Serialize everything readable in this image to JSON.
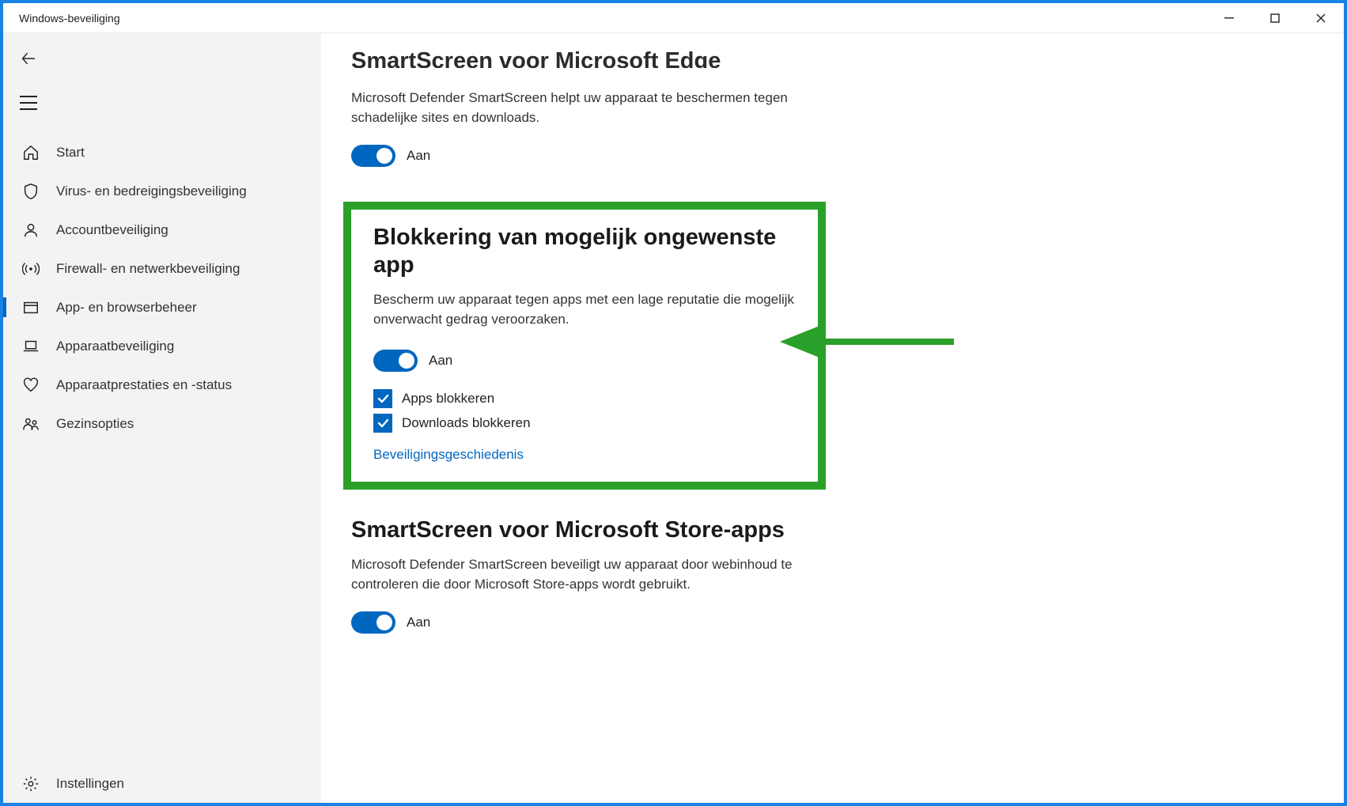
{
  "window": {
    "title": "Windows-beveiliging"
  },
  "sidebar": {
    "items": [
      {
        "label": "Start"
      },
      {
        "label": "Virus- en bedreigingsbeveiliging"
      },
      {
        "label": "Accountbeveiliging"
      },
      {
        "label": "Firewall- en netwerkbeveiliging"
      },
      {
        "label": "App- en browserbeheer"
      },
      {
        "label": "Apparaatbeveiliging"
      },
      {
        "label": "Apparaatprestaties en -status"
      },
      {
        "label": "Gezinsopties"
      }
    ],
    "footer": {
      "label": "Instellingen"
    }
  },
  "main": {
    "section_edge": {
      "title": "SmartScreen voor Microsoft Edge",
      "desc": "Microsoft Defender SmartScreen helpt uw apparaat te beschermen tegen schadelijke sites en downloads.",
      "toggle_label": "Aan"
    },
    "section_pua": {
      "title": "Blokkering van mogelijk ongewenste app",
      "desc": "Bescherm uw apparaat tegen apps met een lage reputatie die mogelijk onverwacht gedrag veroorzaken.",
      "toggle_label": "Aan",
      "checkbox_apps": "Apps blokkeren",
      "checkbox_downloads": "Downloads blokkeren",
      "history_link": "Beveiligingsgeschiedenis"
    },
    "section_store": {
      "title": "SmartScreen voor Microsoft Store-apps",
      "desc": "Microsoft Defender SmartScreen beveiligt uw apparaat door webinhoud te controleren die door Microsoft Store-apps wordt gebruikt.",
      "toggle_label": "Aan"
    }
  },
  "colors": {
    "accent": "#0067c0",
    "highlight": "#2a9f29",
    "frame": "#1a82e2"
  }
}
